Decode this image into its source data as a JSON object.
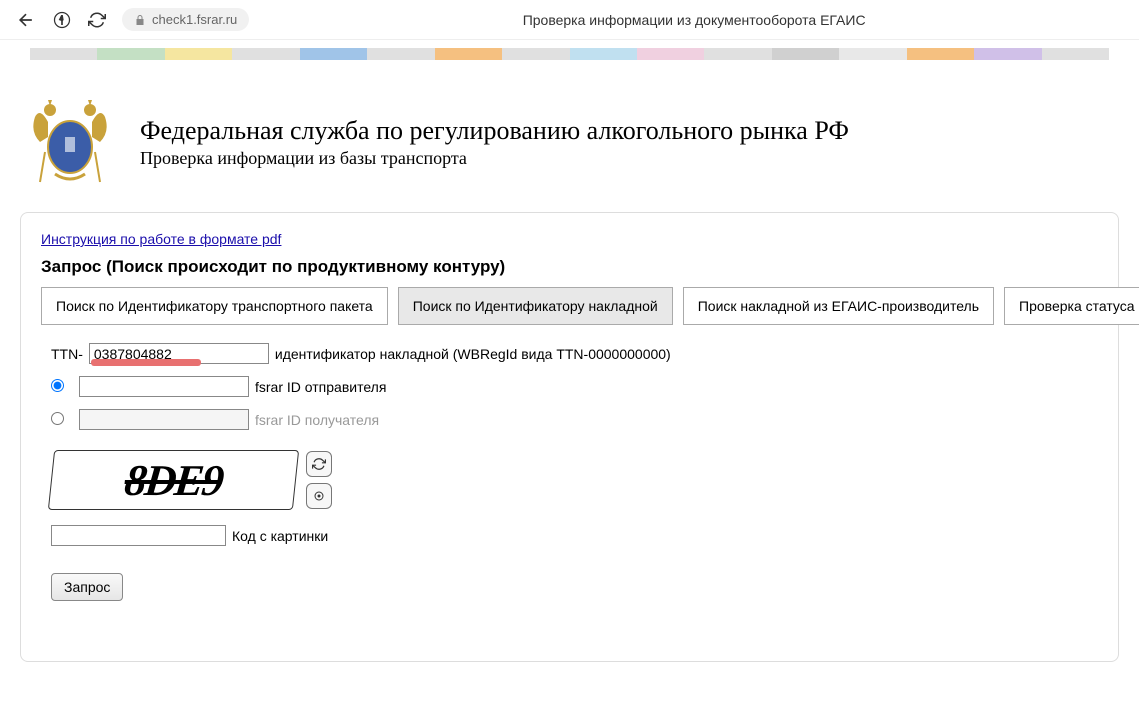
{
  "browser": {
    "url": "check1.fsrar.ru",
    "title": "Проверка информации из документооборота ЕГАИС"
  },
  "header": {
    "title": "Федеральная служба по регулированию алкогольного рынка РФ",
    "subtitle": "Проверка информации из базы транспорта"
  },
  "form": {
    "instruction_link": "Инструкция по работе в формате pdf",
    "title": "Запрос (Поиск происходит по продуктивному контуру)",
    "tabs": [
      "Поиск по Идентификатору транспортного пакета",
      "Поиск по Идентификатору накладной",
      "Поиск накладной из ЕГАИС-производитель",
      "Проверка статуса штрихкода"
    ],
    "ttn_prefix": "TTN-",
    "ttn_value": "0387804882",
    "ttn_hint": "идентификатор накладной (WBRegId вида TTN-0000000000)",
    "sender_label": "fsrar ID отправителя",
    "receiver_label": "fsrar ID получателя",
    "captcha_text": "8DE9",
    "captcha_label": "Код с картинки",
    "submit_label": "Запрос"
  },
  "color_strip": [
    "#e0e0e0",
    "#c4e0c4",
    "#f5e6a0",
    "#e0e0e0",
    "#a0c4e8",
    "#e0e0e0",
    "#f5c080",
    "#e0e0e0",
    "#c0e0f0",
    "#f0d0e0",
    "#e0e0e0",
    "#d0d0d0",
    "#e8e8e8",
    "#f5c080",
    "#d0c0e8",
    "#e0e0e0"
  ]
}
